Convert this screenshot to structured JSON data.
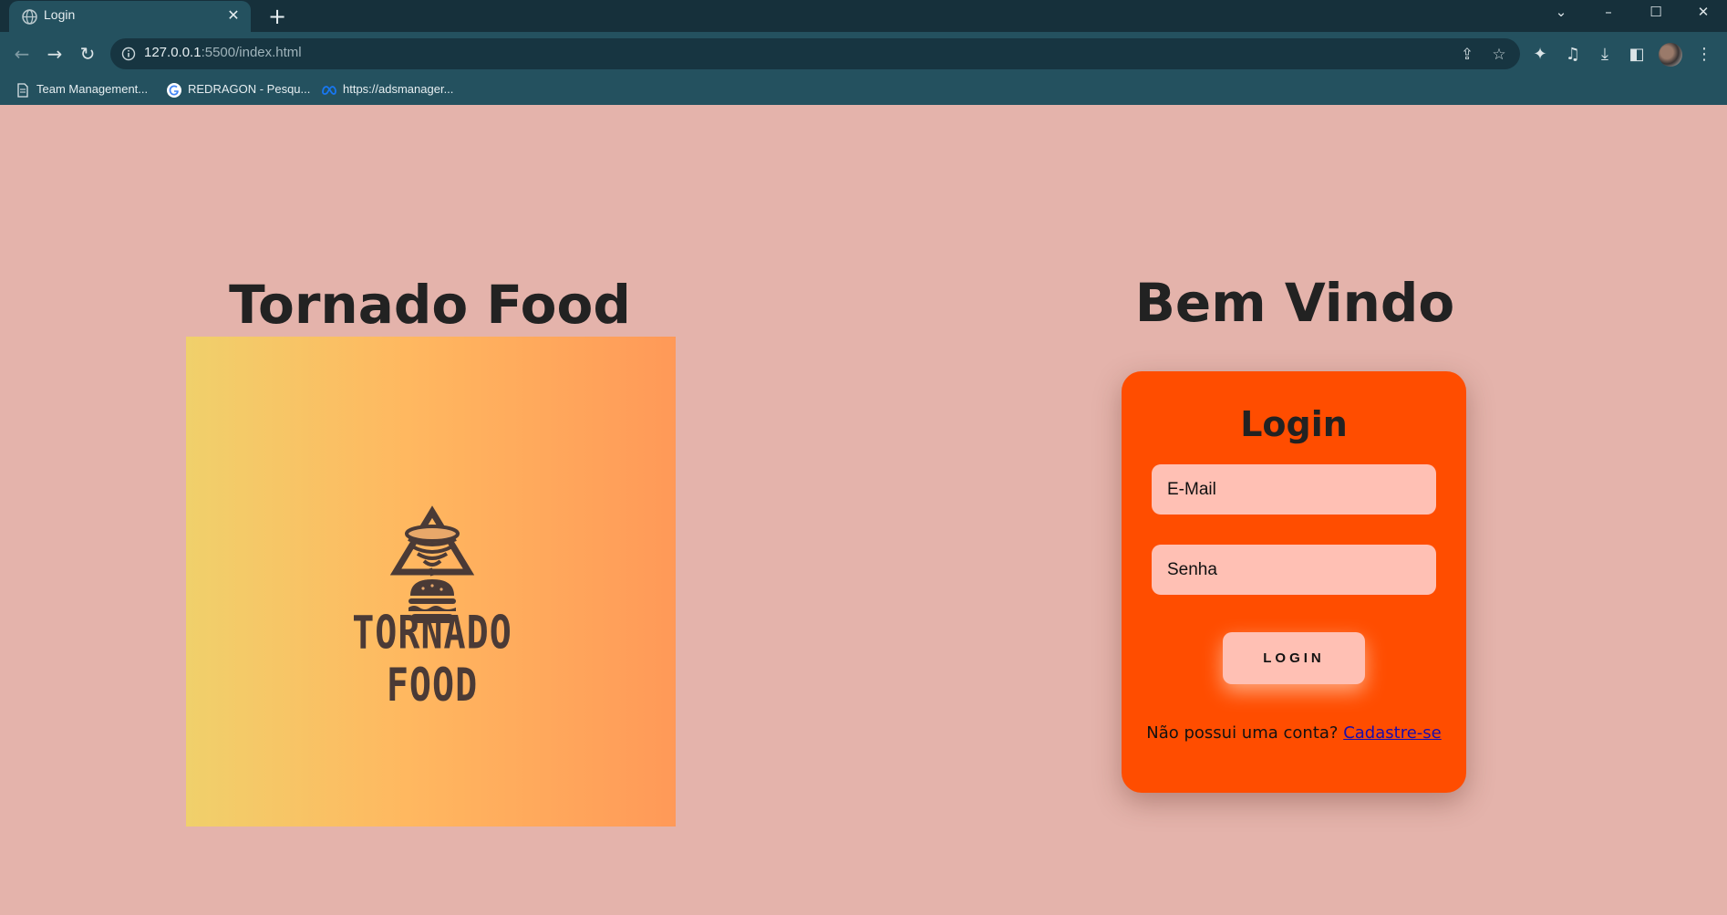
{
  "browser": {
    "tab_title": "Login",
    "url_host": "127.0.0.1",
    "url_rest": ":5500/index.html",
    "bookmarks": [
      {
        "label": "Team Management...",
        "icon": "page-icon"
      },
      {
        "label": "REDRAGON - Pesqu...",
        "icon": "google-icon"
      },
      {
        "label": "https://adsmanager...",
        "icon": "meta-icon"
      }
    ]
  },
  "brand": {
    "title": "Tornado Food",
    "logo_text": "TORNADO FOOD"
  },
  "login": {
    "welcome": "Bem Vindo",
    "card_title": "Login",
    "email_placeholder": "E-Mail",
    "password_placeholder": "Senha",
    "button_label": "LOGIN",
    "signup_prompt": "Não possui uma conta?",
    "signup_link": "Cadastre-se"
  },
  "colors": {
    "page_bg": "#e4b3ab",
    "card_bg": "#ff4d00",
    "field_bg": "#ffc0b4",
    "chrome_dark": "#16303b",
    "chrome_toolbar": "#24515f"
  }
}
